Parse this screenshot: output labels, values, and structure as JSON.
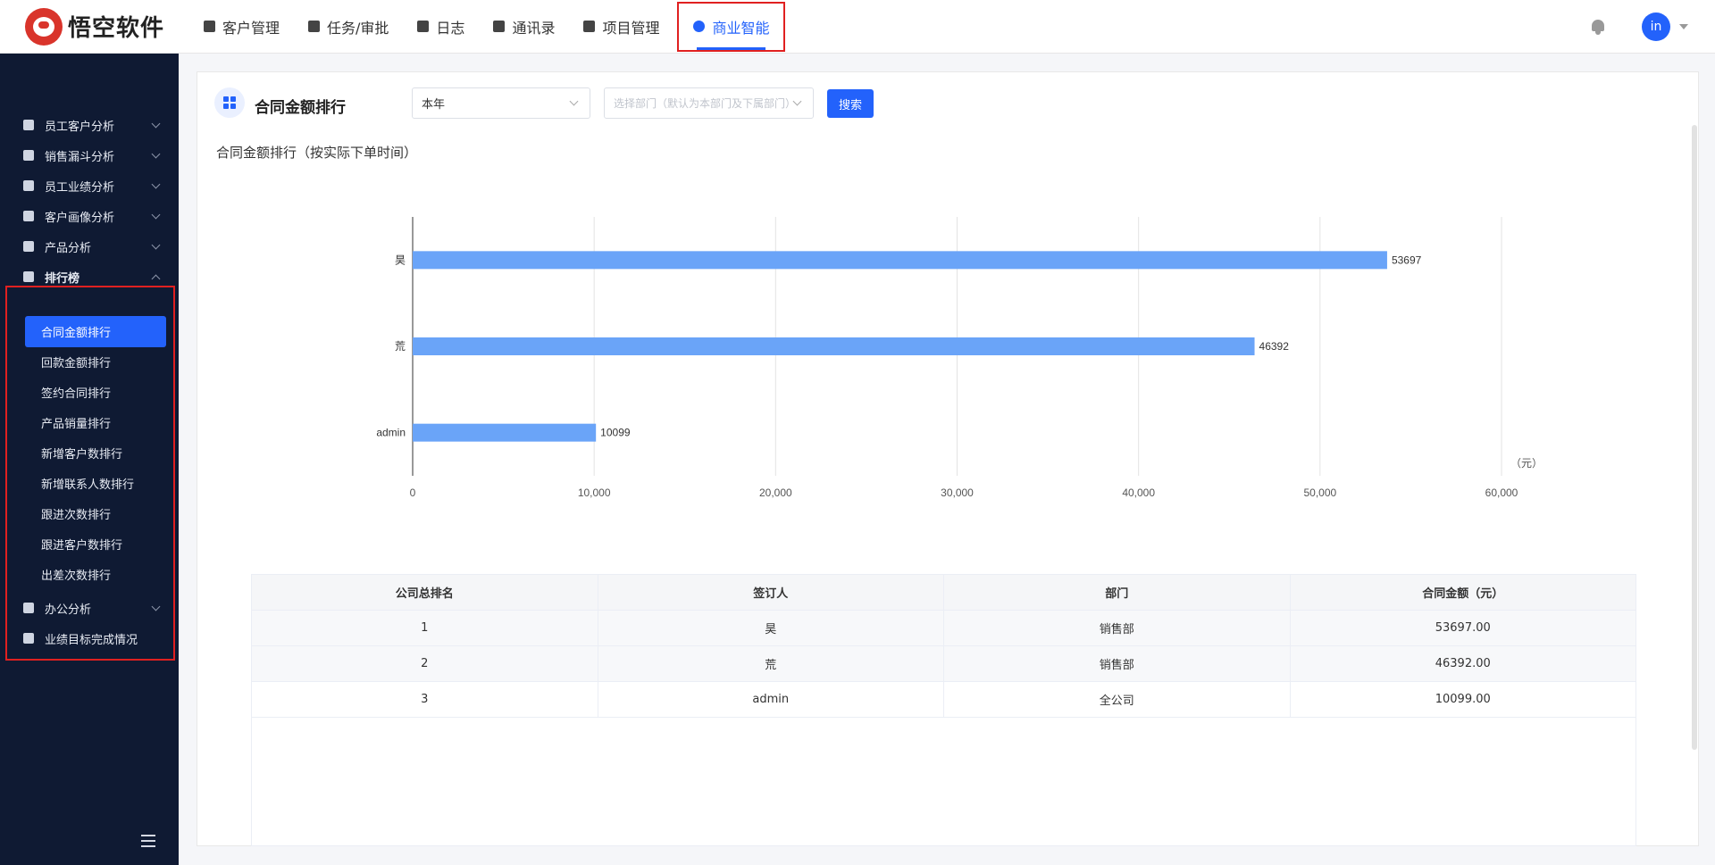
{
  "brand": {
    "name": "悟空软件"
  },
  "nav": [
    {
      "label": "客户管理",
      "icon": "building-icon"
    },
    {
      "label": "任务/审批",
      "icon": "briefcase-icon"
    },
    {
      "label": "日志",
      "icon": "log-icon"
    },
    {
      "label": "通讯录",
      "icon": "contacts-icon"
    },
    {
      "label": "项目管理",
      "icon": "project-icon"
    },
    {
      "label": "商业智能",
      "icon": "bi-icon",
      "active": true
    }
  ],
  "user": {
    "initials": "in"
  },
  "sidebar": {
    "items": [
      {
        "label": "员工客户分析",
        "icon": "person-icon"
      },
      {
        "label": "销售漏斗分析",
        "icon": "funnel-icon"
      },
      {
        "label": "员工业绩分析",
        "icon": "bar-chart-icon"
      },
      {
        "label": "客户画像分析",
        "icon": "users-icon"
      },
      {
        "label": "产品分析",
        "icon": "box-icon"
      },
      {
        "label": "排行榜",
        "icon": "trophy-icon",
        "expanded": true
      },
      {
        "label": "办公分析",
        "icon": "briefcase-icon"
      },
      {
        "label": "业绩目标完成情况",
        "icon": "target-icon"
      }
    ],
    "ranking_sub": [
      {
        "label": "合同金额排行",
        "active": true
      },
      {
        "label": "回款金额排行"
      },
      {
        "label": "签约合同排行"
      },
      {
        "label": "产品销量排行"
      },
      {
        "label": "新增客户数排行"
      },
      {
        "label": "新增联系人数排行"
      },
      {
        "label": "跟进次数排行"
      },
      {
        "label": "跟进客户数排行"
      },
      {
        "label": "出差次数排行"
      }
    ]
  },
  "page": {
    "title": "合同金额排行",
    "period_select": "本年",
    "dept_placeholder": "选择部门（默认为本部门及下属部门）",
    "search_label": "搜索",
    "chart_title": "合同金额排行（按实际下单时间）"
  },
  "chart_data": {
    "type": "bar",
    "orientation": "horizontal",
    "categories": [
      "昊",
      "荒",
      "admin"
    ],
    "values": [
      53697,
      46392,
      10099
    ],
    "xlim": [
      0,
      60000
    ],
    "xticks": [
      "0",
      "10,000",
      "20,000",
      "30,000",
      "40,000",
      "50,000",
      "60,000"
    ],
    "xunit": "（元）",
    "bar_color": "#6aa4f8",
    "grid": true
  },
  "table": {
    "headers": [
      "公司总排名",
      "签订人",
      "部门",
      "合同金额（元）"
    ],
    "rows": [
      [
        "1",
        "昊",
        "销售部",
        "53697.00"
      ],
      [
        "2",
        "荒",
        "销售部",
        "46392.00"
      ],
      [
        "3",
        "admin",
        "全公司",
        "10099.00"
      ]
    ]
  }
}
